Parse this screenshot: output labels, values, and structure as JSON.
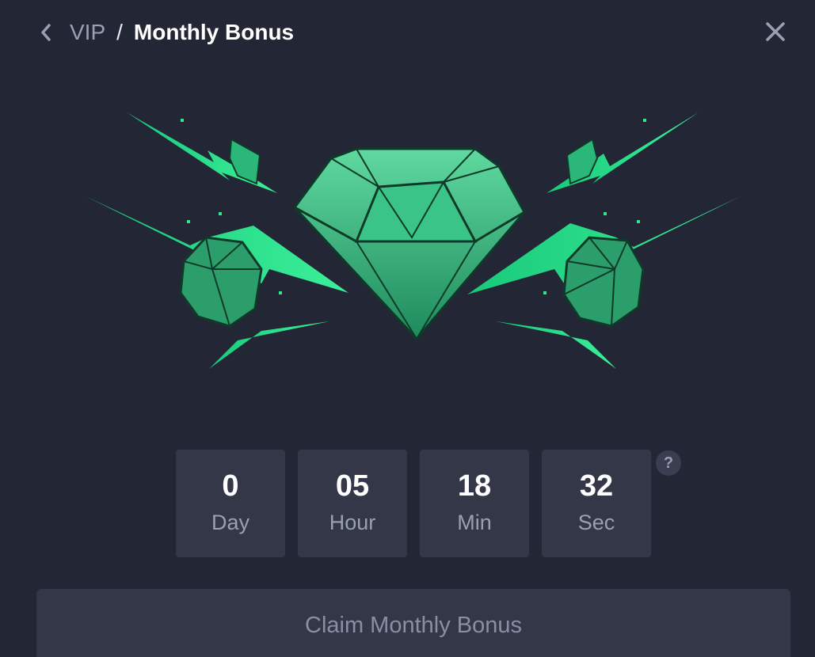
{
  "header": {
    "back_icon": "chevron-left-icon",
    "breadcrumb_parent": "VIP",
    "breadcrumb_separator": "/",
    "breadcrumb_current": "Monthly Bonus",
    "close_icon": "close-icon"
  },
  "hero": {
    "icon": "emerald-diamond-illustration"
  },
  "countdown": {
    "units": [
      {
        "value": "0",
        "label": "Day"
      },
      {
        "value": "05",
        "label": "Hour"
      },
      {
        "value": "18",
        "label": "Min"
      },
      {
        "value": "32",
        "label": "Sec"
      }
    ],
    "help_label": "?"
  },
  "claim_button": {
    "label": "Claim Monthly Bonus"
  },
  "colors": {
    "background": "#232634",
    "panel": "#333747",
    "accent_green": "#2ee88f",
    "muted_text": "#9aa0b3"
  }
}
